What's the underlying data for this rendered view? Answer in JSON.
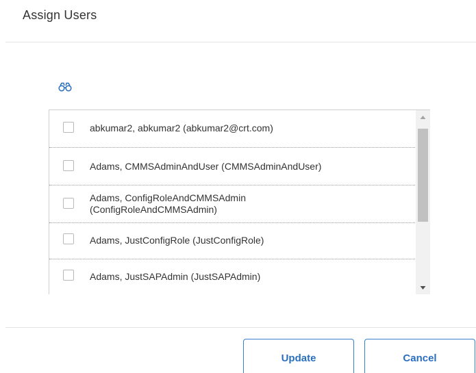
{
  "dialog": {
    "title": "Assign Users"
  },
  "search": {
    "icon": "binoculars-icon"
  },
  "users": [
    {
      "label": "abkumar2, abkumar2 (abkumar2@crt.com)",
      "checked": false
    },
    {
      "label": "Adams, CMMSAdminAndUser (CMMSAdminAndUser)",
      "checked": false
    },
    {
      "label": "Adams, ConfigRoleAndCMMSAdmin\n(ConfigRoleAndCMMSAdmin)",
      "checked": false
    },
    {
      "label": "Adams, JustConfigRole (JustConfigRole)",
      "checked": false
    },
    {
      "label": "Adams, JustSAPAdmin (JustSAPAdmin)",
      "checked": false
    }
  ],
  "footer": {
    "update_label": "Update",
    "cancel_label": "Cancel"
  },
  "colors": {
    "accent": "#2a6fbd",
    "border": "#cfcfcf"
  }
}
